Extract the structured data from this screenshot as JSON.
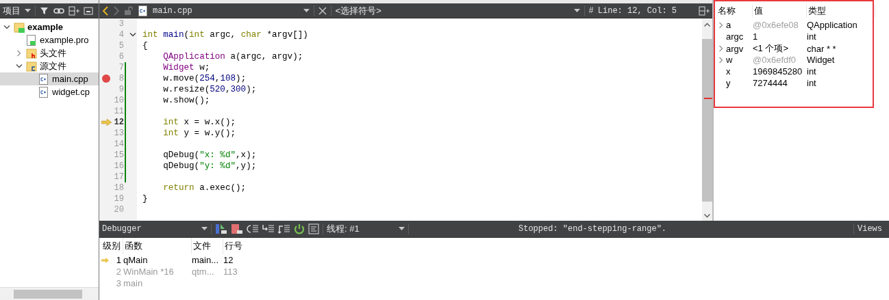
{
  "project_pane": {
    "title": "项目",
    "tree": [
      {
        "label": "example",
        "kind": "project",
        "expanded": true,
        "selected": false,
        "children": [
          {
            "label": "example.pro",
            "kind": "pro",
            "selected": false
          },
          {
            "label": "头文件",
            "kind": "header-folder",
            "expanded": false,
            "selected": false
          },
          {
            "label": "源文件",
            "kind": "source-folder",
            "expanded": true,
            "selected": false,
            "children": [
              {
                "label": "main.cpp",
                "kind": "cpp",
                "selected": true
              },
              {
                "label": "widget.cp",
                "kind": "cpp",
                "selected": false
              }
            ]
          }
        ]
      }
    ]
  },
  "editor": {
    "file_name": "main.cpp",
    "symbol": "<选择符号>",
    "hash": "#",
    "position": "Line: 12, Col: 5",
    "lines": [
      {
        "number": "3",
        "breakpoint": false,
        "current": false,
        "changed": false,
        "foldable": false
      },
      {
        "number": "4",
        "tokens": [
          {
            "text": "int",
            "kind": "keyword"
          },
          {
            "text": " main",
            "kind": "function"
          },
          {
            "text": "(",
            "kind": "plain"
          },
          {
            "text": "int",
            "kind": "keyword"
          },
          {
            "text": " argc, ",
            "kind": "plain"
          },
          {
            "text": "char",
            "kind": "keyword"
          },
          {
            "text": " *argv[])",
            "kind": "plain"
          }
        ],
        "breakpoint": false,
        "current": false,
        "changed": false,
        "foldable": true
      },
      {
        "number": "5",
        "tokens": [
          {
            "text": "{",
            "kind": "plain"
          }
        ],
        "breakpoint": false,
        "current": false,
        "changed": false,
        "foldable": false
      },
      {
        "number": "6",
        "tokens": [
          {
            "text": "    QApplication",
            "kind": "type"
          },
          {
            "text": " a(argc, argv);",
            "kind": "plain"
          }
        ],
        "breakpoint": false,
        "current": false,
        "changed": false,
        "foldable": false
      },
      {
        "number": "7",
        "tokens": [
          {
            "text": "    Widget",
            "kind": "type"
          },
          {
            "text": " w;",
            "kind": "plain"
          }
        ],
        "breakpoint": false,
        "current": false,
        "changed": true,
        "foldable": false
      },
      {
        "number": "8",
        "tokens": [
          {
            "text": "    w.move(",
            "kind": "plain"
          },
          {
            "text": "254",
            "kind": "number"
          },
          {
            "text": ",",
            "kind": "plain"
          },
          {
            "text": "108",
            "kind": "number"
          },
          {
            "text": ");",
            "kind": "plain"
          }
        ],
        "breakpoint": true,
        "current": false,
        "changed": true,
        "foldable": false
      },
      {
        "number": "9",
        "tokens": [
          {
            "text": "    w.resize(",
            "kind": "plain"
          },
          {
            "text": "520",
            "kind": "number"
          },
          {
            "text": ",",
            "kind": "plain"
          },
          {
            "text": "300",
            "kind": "number"
          },
          {
            "text": ");",
            "kind": "plain"
          }
        ],
        "breakpoint": false,
        "current": false,
        "changed": true,
        "foldable": false
      },
      {
        "number": "10",
        "tokens": [
          {
            "text": "    w.show();",
            "kind": "plain"
          }
        ],
        "breakpoint": false,
        "current": false,
        "changed": true,
        "foldable": false
      },
      {
        "number": "11",
        "breakpoint": false,
        "current": false,
        "changed": true,
        "foldable": false
      },
      {
        "number": "12",
        "tokens": [
          {
            "text": "    int",
            "kind": "keyword"
          },
          {
            "text": " x = w.x();",
            "kind": "plain"
          }
        ],
        "breakpoint": false,
        "current": true,
        "changed": true,
        "foldable": false
      },
      {
        "number": "13",
        "tokens": [
          {
            "text": "    int",
            "kind": "keyword"
          },
          {
            "text": " y = w.y();",
            "kind": "plain"
          }
        ],
        "breakpoint": false,
        "current": false,
        "changed": true,
        "foldable": false
      },
      {
        "number": "14",
        "breakpoint": false,
        "current": false,
        "changed": true,
        "foldable": false
      },
      {
        "number": "15",
        "tokens": [
          {
            "text": "    qDebug(",
            "kind": "plain"
          },
          {
            "text": "\"x: %d\"",
            "kind": "string"
          },
          {
            "text": ",x);",
            "kind": "plain"
          }
        ],
        "breakpoint": false,
        "current": false,
        "changed": true,
        "foldable": false
      },
      {
        "number": "16",
        "tokens": [
          {
            "text": "    qDebug(",
            "kind": "plain"
          },
          {
            "text": "\"y: %d\"",
            "kind": "string"
          },
          {
            "text": ",y);",
            "kind": "plain"
          }
        ],
        "breakpoint": false,
        "current": false,
        "changed": true,
        "foldable": false
      },
      {
        "number": "17",
        "breakpoint": false,
        "current": false,
        "changed": true,
        "foldable": false
      },
      {
        "number": "18",
        "tokens": [
          {
            "text": "    return",
            "kind": "keyword"
          },
          {
            "text": " a.exec();",
            "kind": "plain"
          }
        ],
        "breakpoint": false,
        "current": false,
        "changed": false,
        "foldable": false
      },
      {
        "number": "19",
        "tokens": [
          {
            "text": "}",
            "kind": "plain"
          }
        ],
        "breakpoint": false,
        "current": false,
        "changed": false,
        "foldable": false
      },
      {
        "number": "20",
        "breakpoint": false,
        "current": false,
        "changed": false,
        "foldable": false
      }
    ]
  },
  "locals": {
    "columns": [
      "名称",
      "值",
      "类型"
    ],
    "rows": [
      {
        "name": "a",
        "value": "@0x6efe08",
        "type": "QApplication",
        "expandable": true,
        "value_dimmed": true
      },
      {
        "name": "argc",
        "value": "1",
        "type": "int",
        "expandable": false,
        "value_dimmed": false
      },
      {
        "name": "argv",
        "value": "<1 个项>",
        "type": "char * *",
        "expandable": true,
        "value_dimmed": false
      },
      {
        "name": "w",
        "value": "@0x6efdf0",
        "type": "Widget",
        "expandable": true,
        "value_dimmed": true
      },
      {
        "name": "x",
        "value": "1969845280",
        "type": "int",
        "expandable": false,
        "value_dimmed": false
      },
      {
        "name": "y",
        "value": "7274444",
        "type": "int",
        "expandable": false,
        "value_dimmed": false
      }
    ]
  },
  "debugger": {
    "selector": "Debugger",
    "thread": "线程: #1",
    "status": "Stopped: \"end-stepping-range\".",
    "views": "Views",
    "columns": [
      "级别",
      "函数",
      "文件",
      "行号"
    ],
    "frames": [
      {
        "level": "1",
        "function": "qMain",
        "file": "main...",
        "line": "12",
        "current": true,
        "dimmed": false
      },
      {
        "level": "2",
        "function": "WinMain *16",
        "file": "qtm...",
        "line": "113",
        "current": false,
        "dimmed": true
      },
      {
        "level": "3",
        "function": "main",
        "current": false,
        "dimmed": true
      }
    ]
  }
}
